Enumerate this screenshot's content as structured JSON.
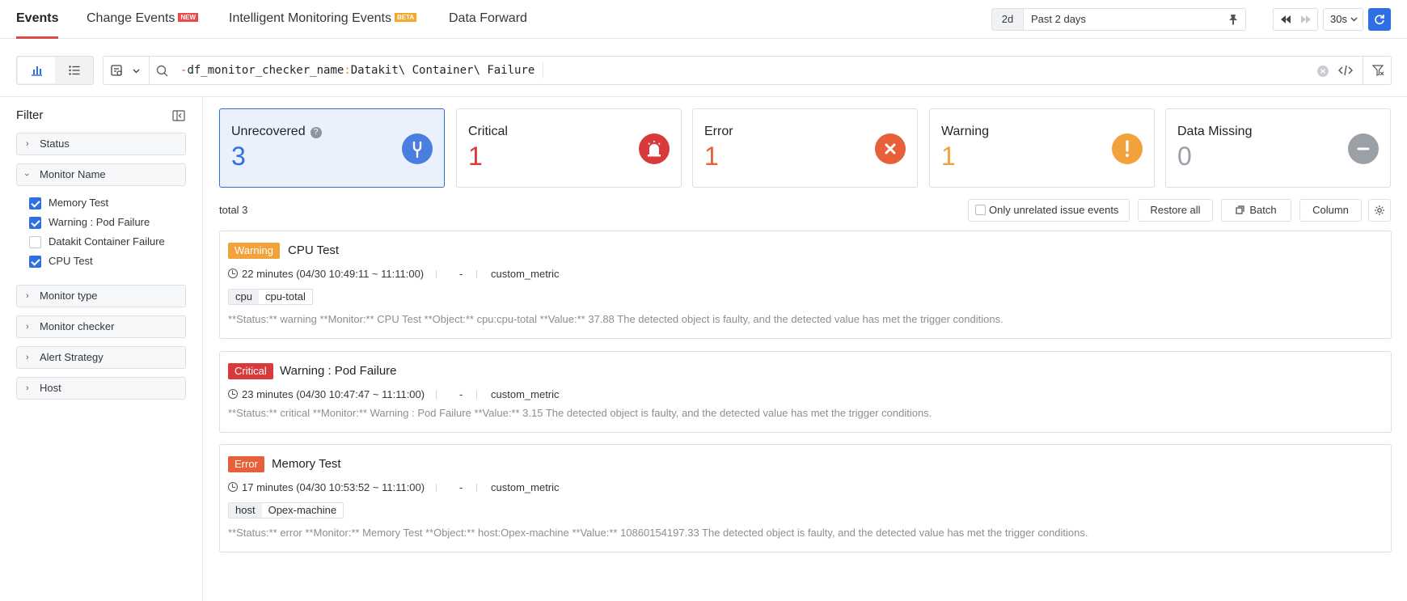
{
  "tabs": [
    {
      "label": "Events"
    },
    {
      "label": "Change Events",
      "badge": "NEW"
    },
    {
      "label": "Intelligent Monitoring Events",
      "badge": "BETA"
    },
    {
      "label": "Data Forward"
    }
  ],
  "time": {
    "short": "2d",
    "range": "Past 2 days",
    "refresh": "30s"
  },
  "query": {
    "prefix": "-",
    "field": "df_monitor_checker_name",
    "colon": ":",
    "value": "Datakit\\ Container\\ Failure"
  },
  "sidebar": {
    "title": "Filter",
    "facets": {
      "status": "Status",
      "monitor_name": "Monitor Name",
      "monitor_type": "Monitor type",
      "monitor_checker": "Monitor checker",
      "alert_strategy": "Alert Strategy",
      "host": "Host"
    },
    "monitor_name_options": [
      {
        "label": "Memory Test",
        "checked": true
      },
      {
        "label": "Warning : Pod Failure",
        "checked": true
      },
      {
        "label": "Datakit Container Failure",
        "checked": false
      },
      {
        "label": "CPU Test",
        "checked": true
      }
    ]
  },
  "cards": [
    {
      "label": "Unrecovered",
      "value": "3",
      "color": "#4a7fe0",
      "icon": "wrench-icon"
    },
    {
      "label": "Critical",
      "value": "1",
      "color": "#d8393b",
      "icon": "siren-icon"
    },
    {
      "label": "Error",
      "value": "1",
      "color": "#e8603a",
      "icon": "x-icon"
    },
    {
      "label": "Warning",
      "value": "1",
      "color": "#f1a23a",
      "icon": "exclamation-icon"
    },
    {
      "label": "Data Missing",
      "value": "0",
      "color": "#9aa0a6",
      "icon": "minus-icon"
    }
  ],
  "toolbar": {
    "total": "total 3",
    "only_unrelated": "Only unrelated issue events",
    "restore_all": "Restore all",
    "batch": "Batch",
    "column": "Column"
  },
  "events": [
    {
      "level": "Warning",
      "level_color": "#f1a23a",
      "title": "CPU Test",
      "duration": "22 minutes (04/30 10:49:11 ~ 11:11:00)",
      "dash": "-",
      "source": "custom_metric",
      "tag_key": "cpu",
      "tag_value": "cpu-total",
      "message": "**Status:** warning **Monitor:** CPU Test **Object:** cpu:cpu-total **Value:** 37.88 The detected object is faulty, and the detected value has met the trigger conditions."
    },
    {
      "level": "Critical",
      "level_color": "#d8393b",
      "title": "Warning : Pod Failure",
      "duration": "23 minutes (04/30 10:47:47 ~ 11:11:00)",
      "dash": "-",
      "source": "custom_metric",
      "message": "**Status:** critical **Monitor:** Warning : Pod Failure **Value:** 3.15 The detected object is faulty, and the detected value has met the trigger conditions."
    },
    {
      "level": "Error",
      "level_color": "#e8603a",
      "title": "Memory Test",
      "duration": "17 minutes (04/30 10:53:52 ~ 11:11:00)",
      "dash": "-",
      "source": "custom_metric",
      "tag_key": "host",
      "tag_value": "Opex-machine",
      "message": "**Status:** error **Monitor:** Memory Test **Object:** host:Opex-machine **Value:** 10860154197.33 The detected object is faulty, and the detected value has met the trigger conditions."
    }
  ]
}
